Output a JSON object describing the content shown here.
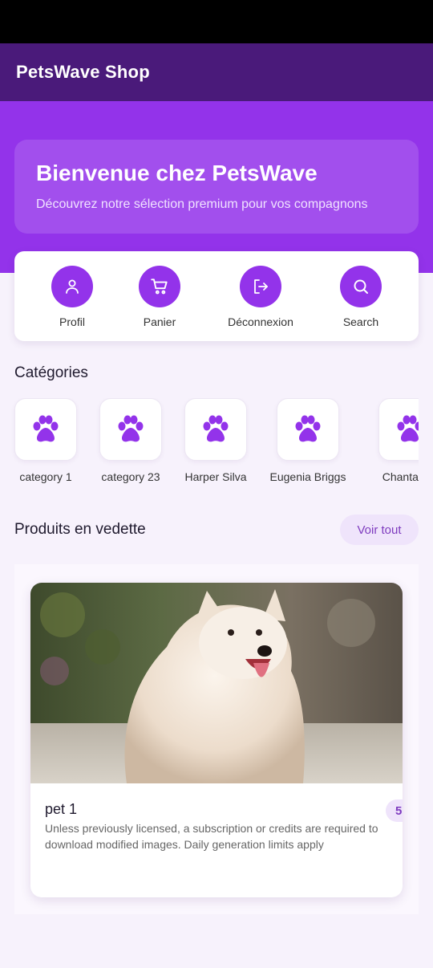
{
  "app": {
    "title": "PetsWave Shop"
  },
  "hero": {
    "title": "Bienvenue chez PetsWave",
    "subtitle": "Découvrez notre sélection premium pour vos compagnons"
  },
  "quick_actions": [
    {
      "label": "Profil",
      "icon": "person-icon"
    },
    {
      "label": "Panier",
      "icon": "cart-icon"
    },
    {
      "label": "Déconnexion",
      "icon": "logout-icon"
    },
    {
      "label": "Search",
      "icon": "search-icon"
    }
  ],
  "categories": {
    "title": "Catégories",
    "items": [
      {
        "label": "category 1",
        "icon": "paw-icon"
      },
      {
        "label": "category 23",
        "icon": "paw-icon"
      },
      {
        "label": "Harper Silva",
        "icon": "paw-icon"
      },
      {
        "label": "Eugenia Briggs",
        "icon": "paw-icon"
      },
      {
        "label": "Chantale A",
        "icon": "paw-icon"
      }
    ]
  },
  "featured": {
    "title": "Produits en vedette",
    "see_all": "Voir tout",
    "products": [
      {
        "name": "pet 1",
        "price": "5",
        "description": "Unless previously licensed, a subscription or credits are required to download modified images. Daily generation limits apply"
      }
    ]
  },
  "colors": {
    "primary": "#9333ea",
    "app_bar": "#4a1a7a",
    "chip_bg": "#efe4fb",
    "chip_text": "#7e3bbf",
    "background": "#f7f2fc"
  }
}
